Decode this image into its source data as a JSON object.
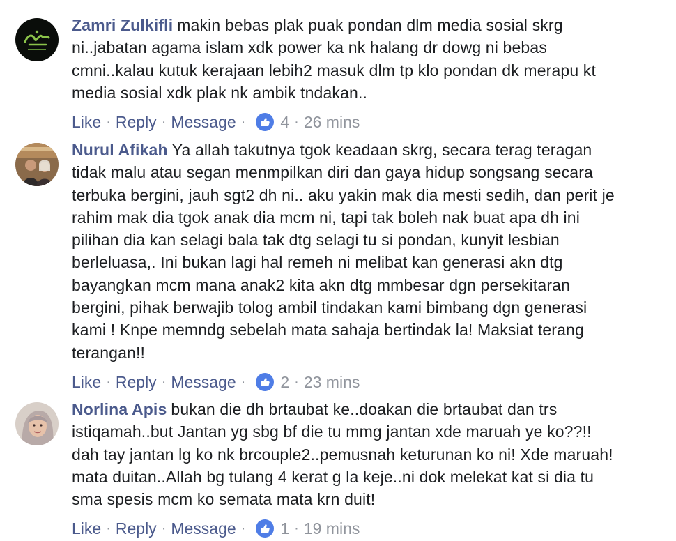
{
  "actions": {
    "like": "Like",
    "reply": "Reply",
    "message": "Message",
    "separator": "·"
  },
  "comments": [
    {
      "author": "Zamri Zulkifli",
      "lines": [
        "makin bebas plak puak pondan dlm media sosial skrg",
        "ni..jabatan agama islam xdk power ka nk halang dr dowg ni bebas",
        "cmni..kalau kutuk kerajaan lebih2 masuk dlm tp klo pondan dk merapu kt",
        "media sosial xdk plak nk ambik tndakan.."
      ],
      "reaction_count": "4",
      "time": "26 mins"
    },
    {
      "author": "Nurul Afikah",
      "lines": [
        "Ya allah takutnya tgok keadaan skrg, secara terag teragan",
        "tidak malu atau segan menmpilkan diri dan gaya hidup songsang secara",
        "terbuka bergini, jauh sgt2 dh ni.. aku yakin mak dia mesti sedih, dan perit je",
        "rahim mak dia tgok anak dia mcm ni, tapi tak boleh nak buat apa dh ini",
        "pilihan dia kan selagi bala tak dtg selagi tu si pondan, kunyit lesbian",
        "berleluasa,. Ini bukan lagi hal remeh ni melibat kan generasi akn dtg",
        "bayangkan mcm mana anak2 kita akn dtg mmbesar dgn persekitaran",
        "bergini, pihak berwajib tolog ambil tindakan kami bimbang dgn generasi",
        "kami ! Knpe memndg sebelah mata sahaja bertindak la! Maksiat terang",
        "terangan!!"
      ],
      "reaction_count": "2",
      "time": "23 mins"
    },
    {
      "author": "Norlina Apis",
      "lines": [
        "bukan die dh brtaubat ke..doakan die brtaubat dan trs",
        "istiqamah..but Jantan yg sbg bf die tu mmg jantan xde maruah ye ko??!!",
        "dah tay jantan lg ko nk brcouple2..pemusnah keturunan ko ni! Xde maruah!",
        "mata duitan..Allah bg tulang 4 kerat g la keje..ni dok melekat kat si dia tu",
        "sma spesis mcm ko semata mata krn duit!"
      ],
      "reaction_count": "1",
      "time": "19 mins"
    }
  ],
  "colors": {
    "author": "#4b5a8c",
    "link": "#4b5a8c",
    "meta": "#90949c",
    "like_badge": "#4f7de6",
    "text": "#1c1e21"
  },
  "icons": {
    "reaction": "thumbs-up-icon"
  }
}
